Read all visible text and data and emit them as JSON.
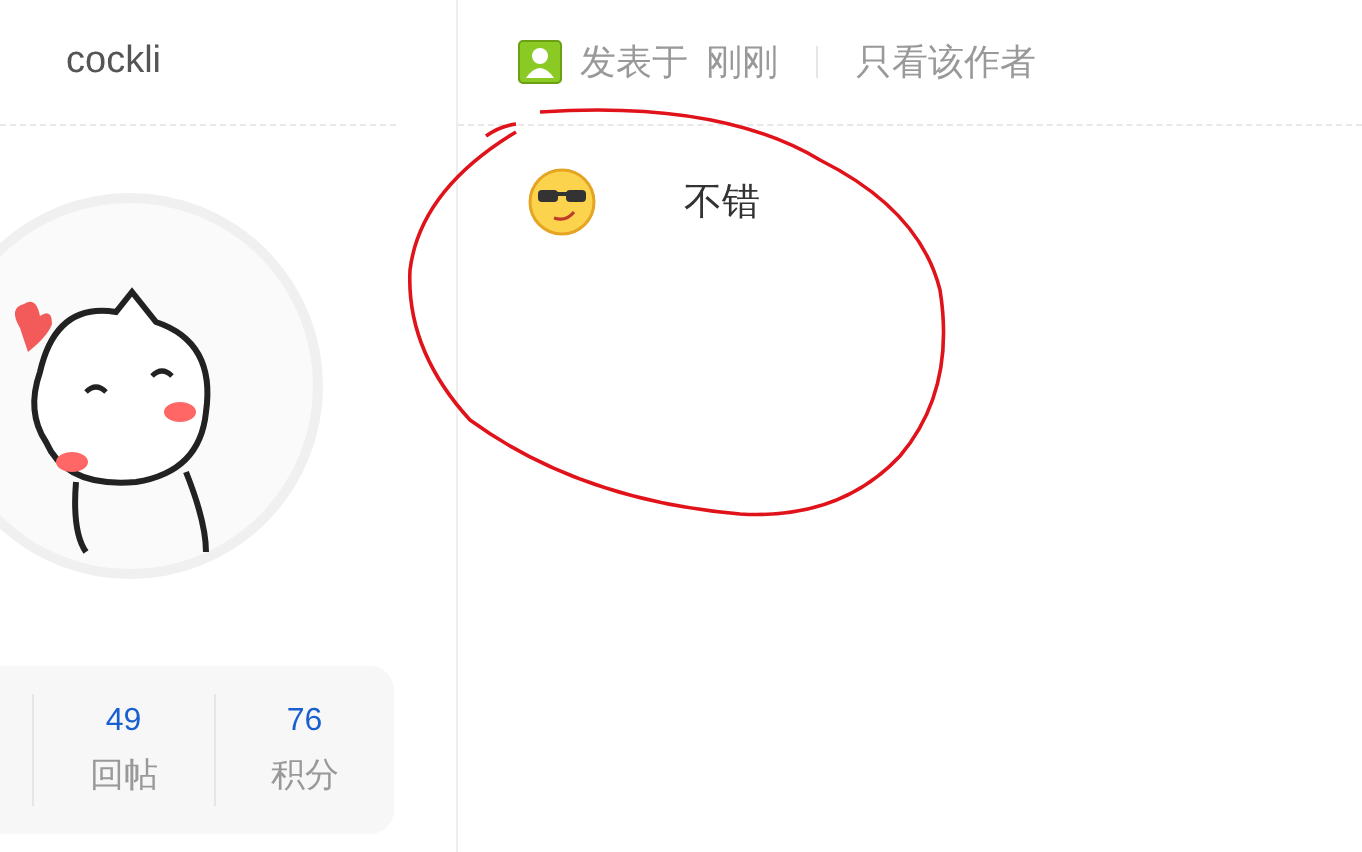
{
  "author": {
    "name": "cockli"
  },
  "stats": [
    {
      "value": "49",
      "label": "回帖"
    },
    {
      "value": "76",
      "label": "积分"
    }
  ],
  "post_meta": {
    "posted_label": "发表于",
    "time": "刚刚",
    "filter_link": "只看该作者"
  },
  "post": {
    "text": "不错"
  }
}
